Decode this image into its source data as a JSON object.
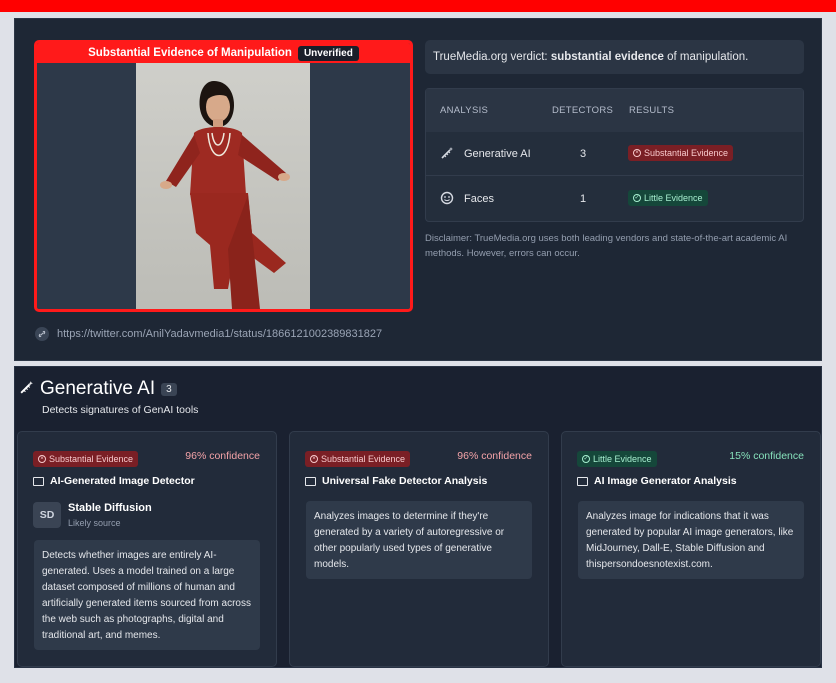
{
  "media": {
    "title": "Substantial Evidence of Manipulation",
    "status_badge": "Unverified",
    "url": "https://twitter.com/AnilYadavmedia1/status/1866121002389831827"
  },
  "verdict": {
    "prefix": "TrueMedia.org verdict: ",
    "strong": "substantial evidence",
    "suffix": " of manipulation."
  },
  "analysis_table": {
    "headers": [
      "ANALYSIS",
      "DETECTORS",
      "RESULTS"
    ],
    "rows": [
      {
        "icon": "magic-wand-icon",
        "name": "Generative AI",
        "detectors": "3",
        "result": "Substantial Evidence",
        "result_color": "#7a1f25"
      },
      {
        "icon": "face-icon",
        "name": "Faces",
        "detectors": "1",
        "result": "Little Evidence",
        "result_color": "#15473a"
      }
    ]
  },
  "disclaimer": "Disclaimer: TrueMedia.org uses both leading vendors and state-of-the-art academic AI methods. However, errors can occur.",
  "section": {
    "icon": "magic-wand-icon",
    "title": "Generative AI",
    "count": "3",
    "subtitle": "Detects signatures of GenAI tools"
  },
  "cards": [
    {
      "badge": "Substantial Evidence",
      "confidence": "96% confidence",
      "title": "AI-Generated Image Detector",
      "source_initials": "SD",
      "source_name": "Stable Diffusion",
      "source_sub": "Likely source",
      "description": "Detects whether images are entirely AI-generated. Uses a model trained on a large dataset composed of millions of human and artificially generated items sourced from across the web such as photographs, digital and traditional art, and memes."
    },
    {
      "badge": "Substantial Evidence",
      "confidence": "96% confidence",
      "title": "Universal Fake Detector Analysis",
      "description": "Analyzes images to determine if they're generated by a variety of autoregressive or other popularly used types of generative models."
    },
    {
      "badge": "Little Evidence",
      "confidence": "15% confidence",
      "title": "AI Image Generator Analysis",
      "description": "Analyzes image for indications that it was generated by popular AI image generators, like MidJourney, Dall-E, Stable Diffusion and thispersondoesnotexist.com."
    }
  ],
  "colors": {
    "alert_red": "#ff1a1a",
    "panel_bg": "#1e2735",
    "page_bg": "#dfe1e8"
  }
}
